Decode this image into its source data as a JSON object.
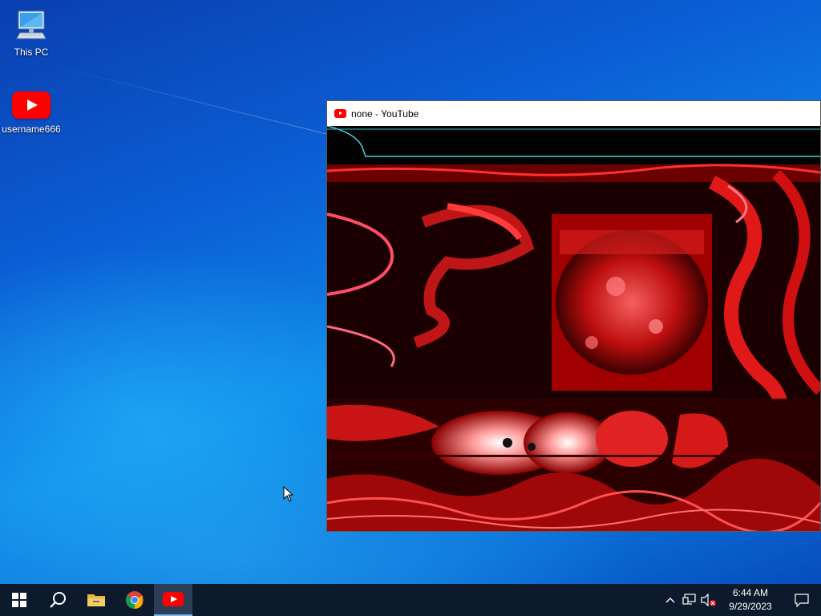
{
  "desktop": {
    "icons": [
      {
        "label": "This PC",
        "icon": "computer-icon"
      },
      {
        "label": "username666",
        "icon": "youtube-icon"
      }
    ]
  },
  "window": {
    "title": "none - YouTube",
    "app_icon": "youtube-icon",
    "content": "abstract distorted red imagery"
  },
  "taskbar": {
    "buttons": [
      {
        "name": "start-button",
        "icon": "windows-logo-icon"
      },
      {
        "name": "search-button",
        "icon": "search-icon"
      },
      {
        "name": "file-explorer-button",
        "icon": "folder-icon"
      },
      {
        "name": "chrome-button",
        "icon": "chrome-icon"
      },
      {
        "name": "youtube-button",
        "icon": "youtube-icon",
        "active": true
      }
    ],
    "tray": {
      "icons": [
        "chevron-up-icon",
        "network-icon",
        "speaker-muted-icon"
      ],
      "time": "6:44 AM",
      "date": "9/29/2023",
      "notification_icon": "action-center-icon"
    }
  },
  "colors": {
    "taskbar_bg": "#0c1a2b",
    "active_task": "#2a3e57",
    "youtube_red": "#ff0000",
    "desktop_blue": "#0b5ed4"
  }
}
